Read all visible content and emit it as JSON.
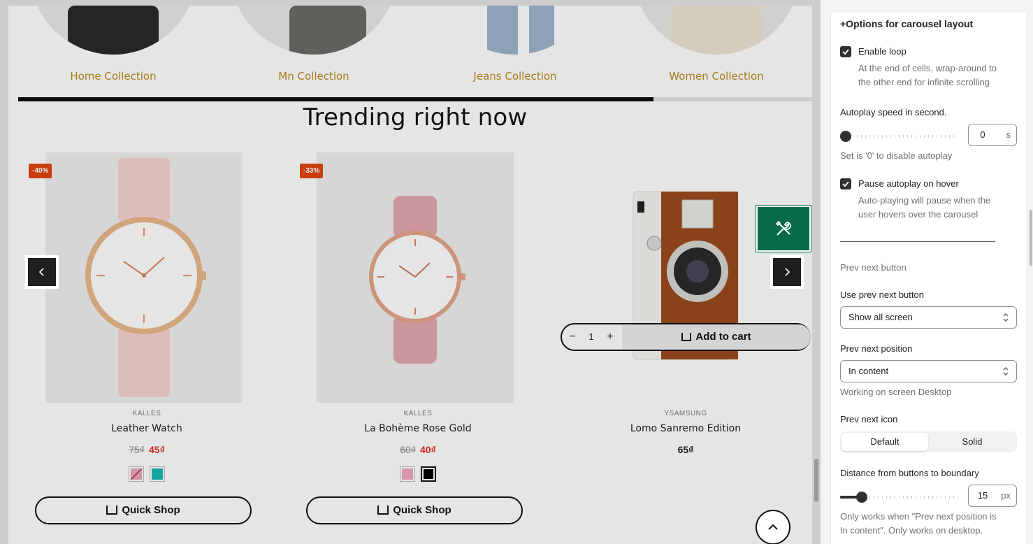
{
  "preview": {
    "collections": [
      {
        "label": "Home Collection"
      },
      {
        "label": "Mn Collection"
      },
      {
        "label": "Jeans Collection"
      },
      {
        "label": "Women Collection"
      }
    ],
    "carousel_progress_percent": 80,
    "section_title": "Trending right now",
    "products": [
      {
        "badge": "-40%",
        "vendor": "KALLES",
        "name": "Leather Watch",
        "old_price": "75₫",
        "price": "45₫",
        "swatch_colors": [
          "#e7a9b8",
          "#17b8b4"
        ],
        "action": "Quick Shop"
      },
      {
        "badge": "-33%",
        "vendor": "KALLES",
        "name": "La Bohème Rose Gold",
        "old_price": "60₫",
        "price": "40₫",
        "swatch_colors": [
          "#f1a9bd",
          "#000000"
        ],
        "action": "Quick Shop"
      },
      {
        "vendor": "YSAMSUNG",
        "name": "Lomo Sanremo Edition",
        "price": "65₫",
        "quantity": "1",
        "minus": "−",
        "plus": "+",
        "action": "Add to cart"
      }
    ],
    "icons": {
      "prev": "chevron-left-icon",
      "next": "chevron-right-icon",
      "tools": "tools-icon",
      "top": "chevron-up-icon",
      "cart": "cart-icon"
    },
    "colors": {
      "accent_gold": "#b88b1c",
      "badge": "#e0450f",
      "sale_price": "#e02b27",
      "tool_button": "#076b4a"
    }
  },
  "settings": {
    "section_title": "+Options for carousel layout",
    "enable_loop": {
      "label": "Enable loop",
      "checked": true,
      "help": [
        "At the end of cells, wrap-around to",
        "the other end for infinite scrolling"
      ]
    },
    "autoplay_speed": {
      "label": "Autoplay speed in second.",
      "value": "0",
      "unit": "s",
      "help": "Set is '0' to disable autoplay"
    },
    "pause_on_hover": {
      "label": "Pause autoplay on hover",
      "checked": true,
      "help": [
        "Auto-playing will pause when the",
        "user hovers over the carousel"
      ]
    },
    "prev_next_heading": "Prev next button",
    "use_prev_next": {
      "label": "Use prev next button",
      "value": "Show all screen"
    },
    "prev_next_position": {
      "label": "Prev next position",
      "value": "In content",
      "help": "Working on screen Desktop"
    },
    "prev_next_icon": {
      "label": "Prev next icon",
      "options": [
        "Default",
        "Solid"
      ],
      "selected": "Default"
    },
    "distance": {
      "label": "Distance from buttons to boundary",
      "value": "15",
      "unit": "px",
      "help": [
        "Only works when \"Prev next position is",
        "In content\". Only works on desktop."
      ]
    }
  }
}
